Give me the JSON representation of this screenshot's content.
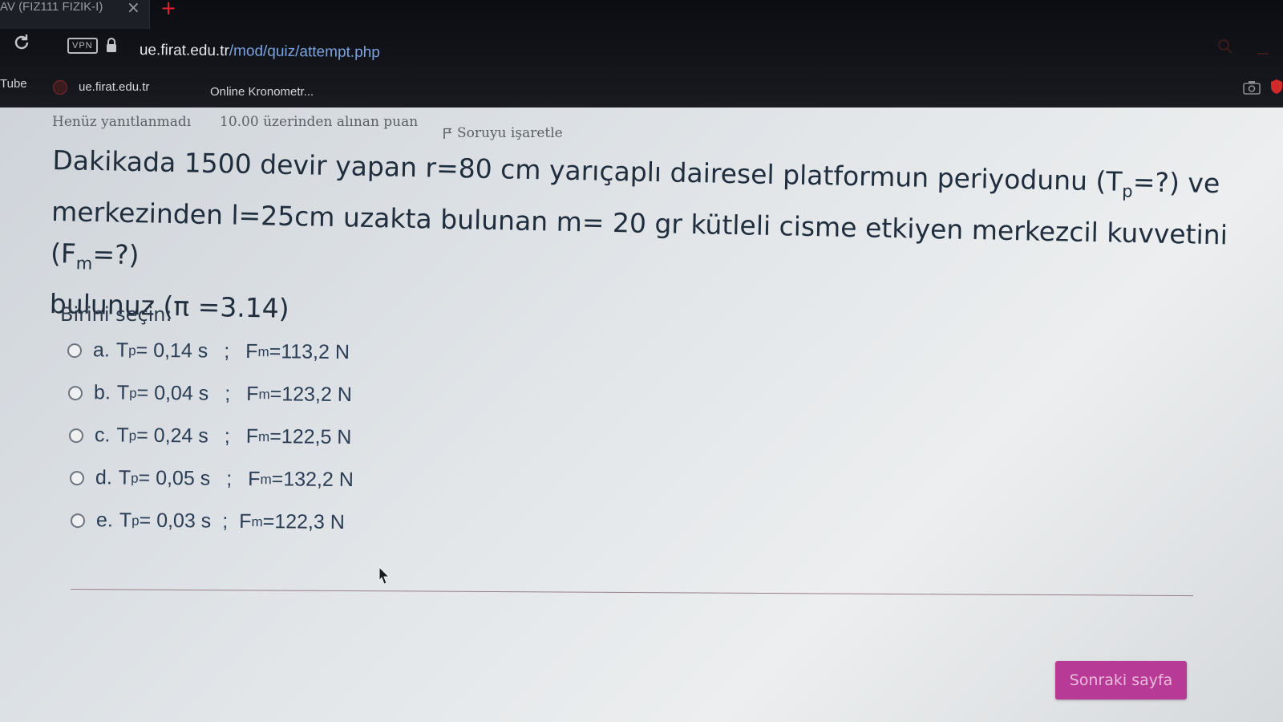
{
  "browser": {
    "tab_title": "AV (FIZ111 FIZIK-I)",
    "vpn_label": "VPN",
    "url_host": "ue.firat.edu.tr",
    "url_path": "/mod/quiz/attempt.php",
    "bookmarks": [
      {
        "label": "Tube"
      },
      {
        "label": "ue.firat.edu.tr"
      },
      {
        "label": "Online Kronometr..."
      }
    ]
  },
  "question_meta": {
    "status": "Henüz yanıtlanmadı",
    "points": "10.00 üzerinden alınan puan",
    "flag_label": "Soruyu işaretle"
  },
  "question": {
    "line1_a": "Dakikada 1500 devir yapan  r=80 cm  yarıçaplı dairesel platformun periyodunu (T",
    "line1_sub": "p",
    "line1_b": "=?) ve",
    "line2_a": "merkezinden  l=25cm uzakta bulunan  m= 20 gr kütleli cisme etkiyen merkezcil kuvvetini (F",
    "line2_sub": "m",
    "line2_b": "=?)",
    "line3": "bulunuz (π =3.14)"
  },
  "prompt": "Birini seçin:",
  "options": [
    {
      "letter": "a.",
      "t_value": "= 0,14 s",
      "f_value": "=113,2 N"
    },
    {
      "letter": "b.",
      "t_value": "= 0,04 s",
      "f_value": "=123,2 N"
    },
    {
      "letter": "c.",
      "t_value": "= 0,24 s",
      "f_value": "=122,5 N"
    },
    {
      "letter": "d.",
      "t_value": "= 0,05 s",
      "f_value": "=132,2 N"
    },
    {
      "letter": "e.",
      "t_value": "= 0,03 s",
      "f_value": "=122,3 N"
    }
  ],
  "symbols": {
    "t": "T",
    "t_sub": "p",
    "f": "F",
    "f_sub": "m",
    "separator": ";"
  },
  "next_button": "Sonraki sayfa",
  "colors": {
    "accent_button": "#b83a97",
    "url_path": "#7aa3e0",
    "new_tab": "#e0242c"
  }
}
